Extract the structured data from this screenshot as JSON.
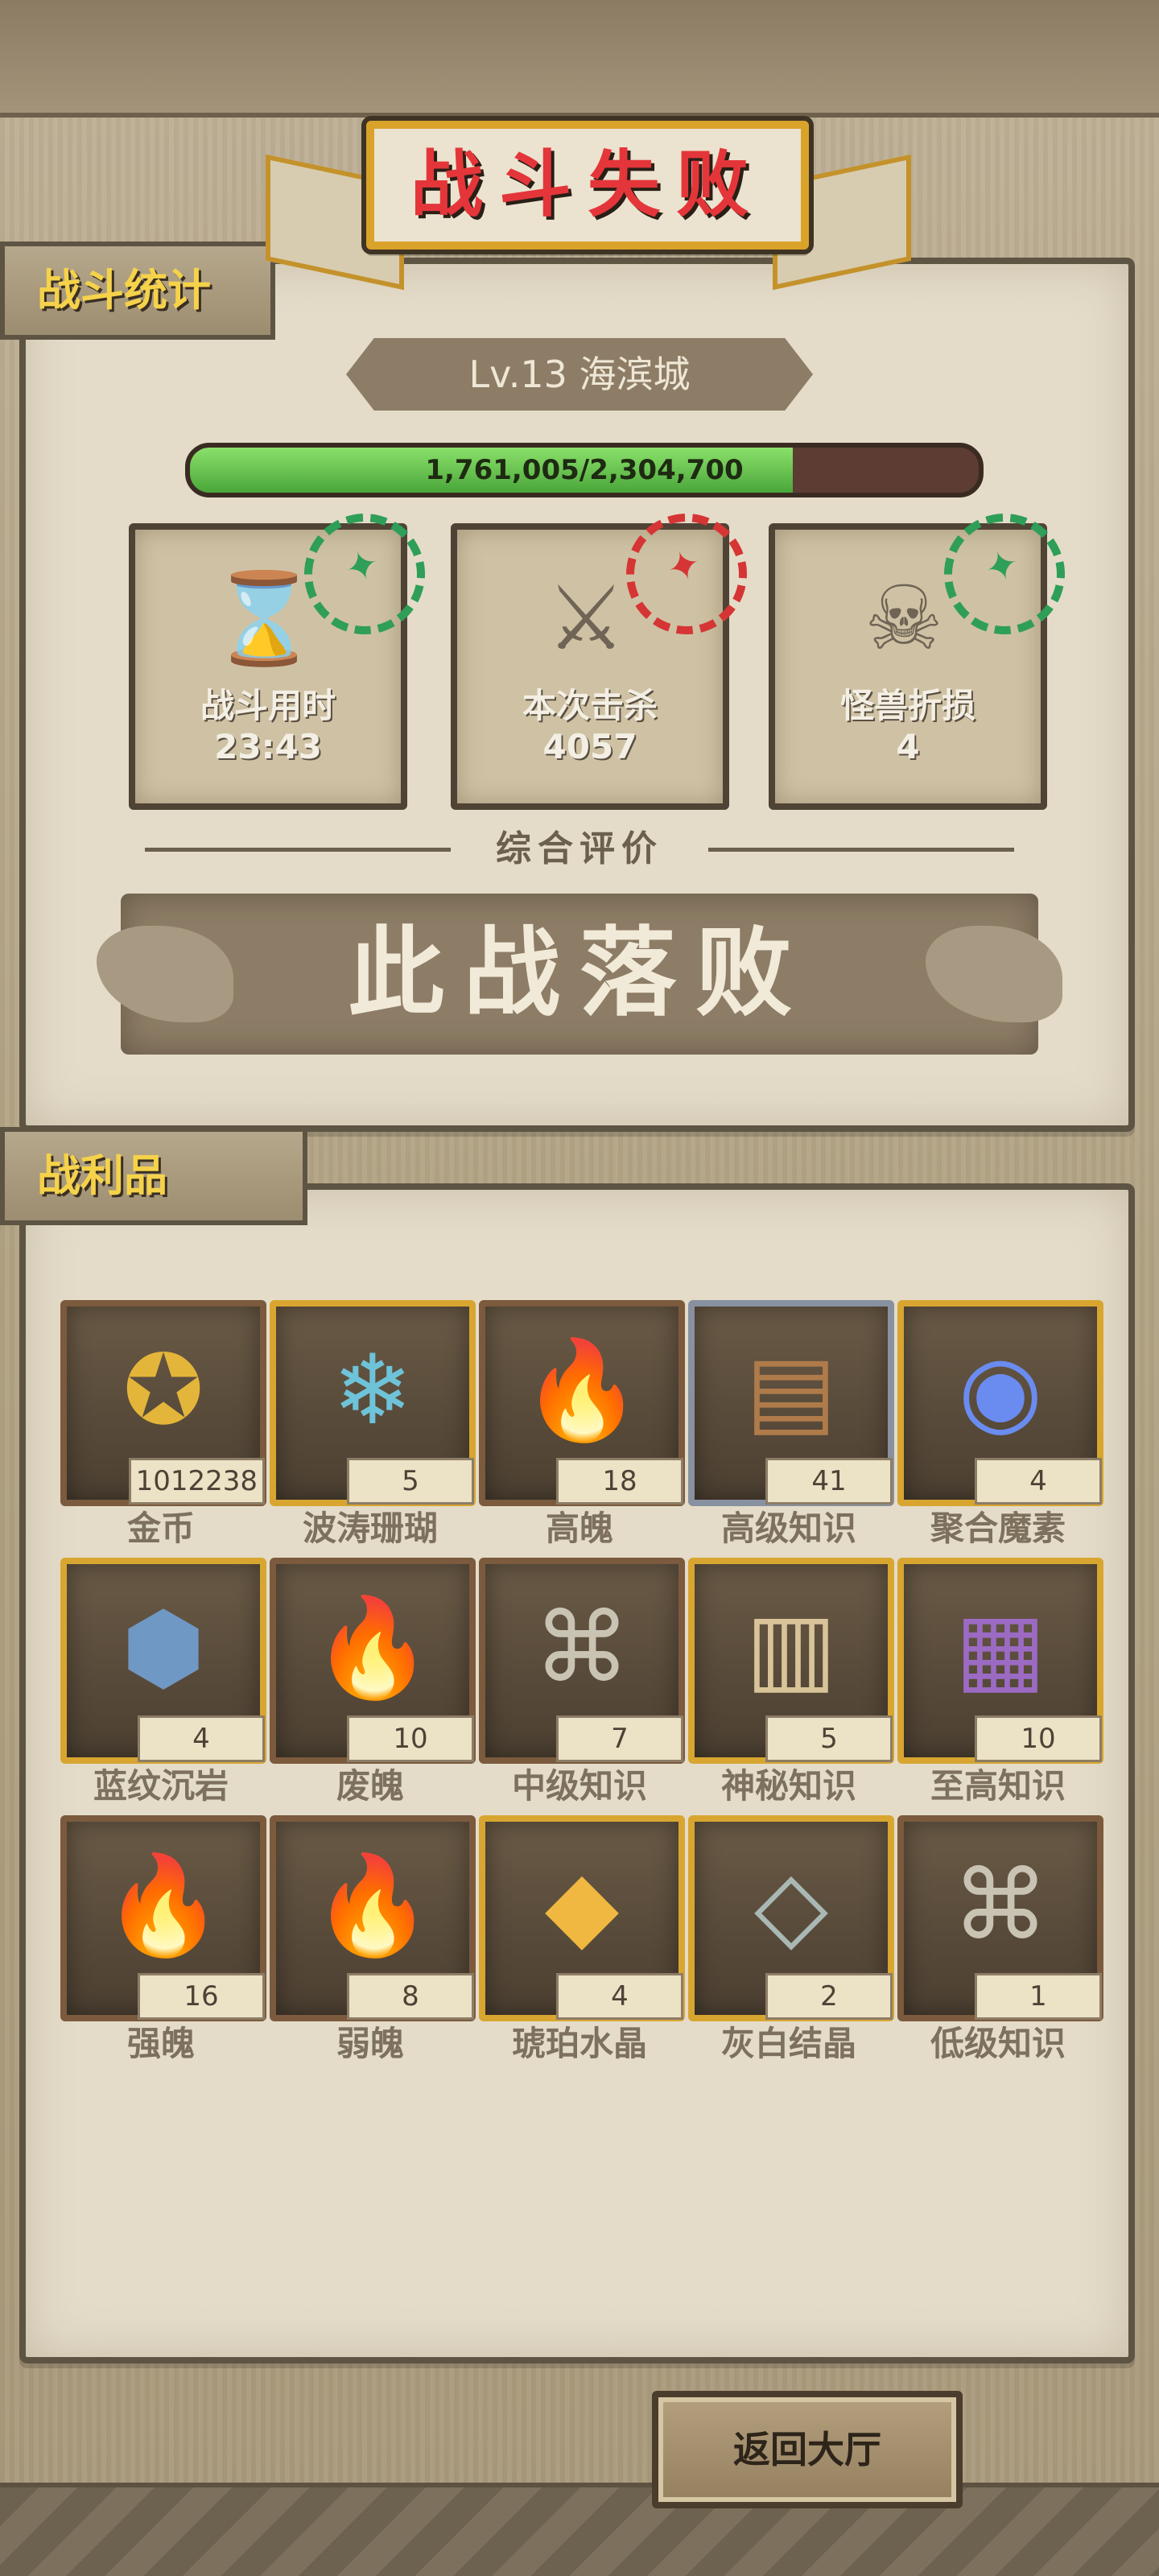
{
  "result": {
    "title": "战斗失败"
  },
  "stats": {
    "tag": "战斗统计",
    "level": "Lv.13 海滨城",
    "hp": {
      "text": "1,761,005/2,304,700",
      "current": 1761005,
      "max": 2304700
    },
    "cards": [
      {
        "label": "战斗用时",
        "value": "23:43",
        "icon": "hourglass-icon",
        "stamp": "green"
      },
      {
        "label": "本次击杀",
        "value": "4057",
        "icon": "crossed-swords-icon",
        "stamp": "red"
      },
      {
        "label": "怪兽折损",
        "value": "4",
        "icon": "skull-icon",
        "stamp": "green"
      }
    ],
    "rating_label": "综合评价",
    "verdict": "此战落败"
  },
  "loot": {
    "tag": "战利品",
    "items": [
      {
        "name": "金币",
        "count": "1012238",
        "icon": "gold-coin-icon",
        "frame": "plain"
      },
      {
        "name": "波涛珊瑚",
        "count": "5",
        "icon": "coral-icon",
        "frame": "gold"
      },
      {
        "name": "高魄",
        "count": "18",
        "icon": "flame-icon",
        "frame": "plain"
      },
      {
        "name": "高级知识",
        "count": "41",
        "icon": "book-icon",
        "frame": "silver"
      },
      {
        "name": "聚合魔素",
        "count": "4",
        "icon": "magic-orb-icon",
        "frame": "gold"
      },
      {
        "name": "蓝纹沉岩",
        "count": "4",
        "icon": "blue-rock-icon",
        "frame": "gold"
      },
      {
        "name": "废魄",
        "count": "10",
        "icon": "flame-icon",
        "frame": "plain"
      },
      {
        "name": "中级知识",
        "count": "7",
        "icon": "scroll-icon",
        "frame": "plain"
      },
      {
        "name": "神秘知识",
        "count": "5",
        "icon": "tablet-icon",
        "frame": "gold"
      },
      {
        "name": "至高知识",
        "count": "10",
        "icon": "tome-icon",
        "frame": "gold"
      },
      {
        "name": "强魄",
        "count": "16",
        "icon": "flame-icon",
        "frame": "plain"
      },
      {
        "name": "弱魄",
        "count": "8",
        "icon": "flame-icon",
        "frame": "plain"
      },
      {
        "name": "琥珀水晶",
        "count": "4",
        "icon": "amber-crystal-icon",
        "frame": "gold"
      },
      {
        "name": "灰白结晶",
        "count": "2",
        "icon": "grey-crystal-icon",
        "frame": "gold"
      },
      {
        "name": "低级知识",
        "count": "1",
        "icon": "scroll-icon",
        "frame": "plain"
      }
    ]
  },
  "actions": {
    "return_label": "返回大厅"
  },
  "colors": {
    "title_red": "#e4363a",
    "tag_gold": "#f5d24a",
    "stamp_green": "#2f9e58",
    "stamp_red": "#d63535",
    "hp_green": "#4aa63a"
  }
}
